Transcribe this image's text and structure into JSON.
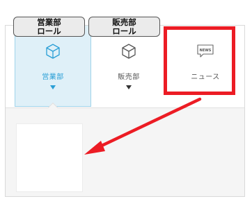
{
  "roles": {
    "sales_department": [
      "営業部",
      "ロール"
    ],
    "sales": [
      "販売部",
      "ロール"
    ]
  },
  "tiles": [
    {
      "label": "営業部",
      "icon": "cube-icon",
      "selected": true
    },
    {
      "label": "販売部",
      "icon": "cube-icon",
      "selected": false
    },
    {
      "label": "ニュース",
      "icon": "news-icon",
      "selected": false
    }
  ],
  "news_icon_text": "NEWS",
  "colors": {
    "accent": "#2a9fd6",
    "selected_bg": "#dff0f8",
    "highlight": "#ec1c24",
    "annotation_label_bg": "#ebebeb"
  }
}
